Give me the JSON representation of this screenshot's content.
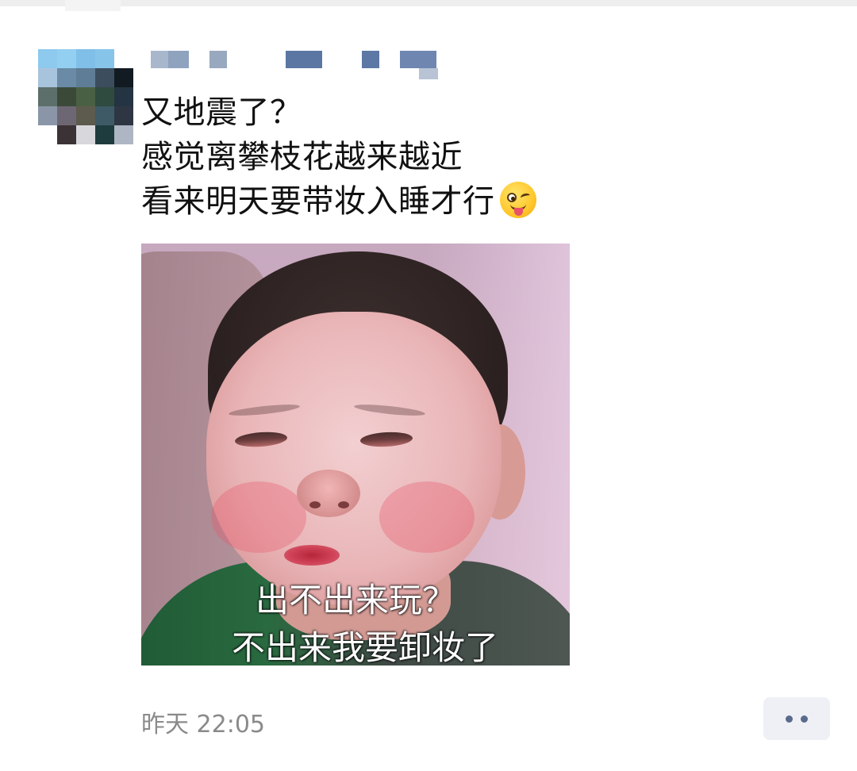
{
  "post": {
    "text_lines": [
      "又地震了？",
      "感觉离攀枝花越来越近",
      "看来明天要带妆入睡才行"
    ],
    "emoji": "winking-face-with-tongue-icon",
    "image_captions": [
      "出不出来玩？",
      "不出来我要卸妆了"
    ],
    "timestamp": "昨天 22:05"
  },
  "colors": {
    "background": "#ffffff",
    "text": "#111111",
    "timestamp": "#8a8a8a",
    "more_button_bg": "#eef0f5",
    "more_button_dots": "#5a6a8c"
  },
  "icons": {
    "avatar": "avatar-pixelated",
    "nickname": "nickname-pixelated",
    "more": "more-dots-icon"
  }
}
